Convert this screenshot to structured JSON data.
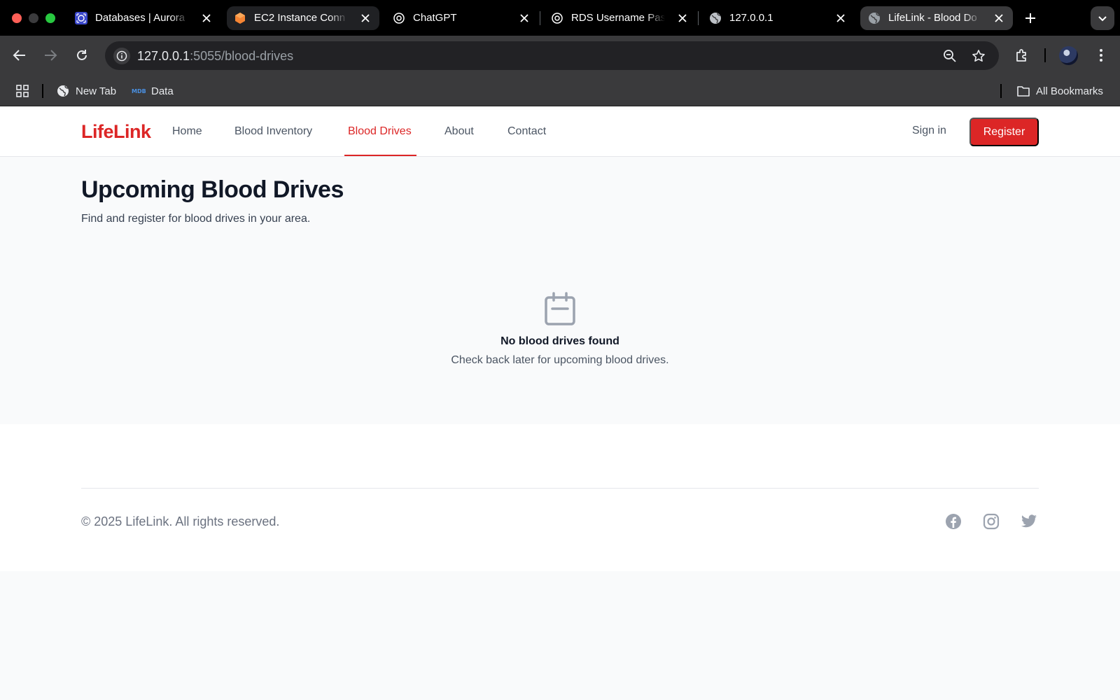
{
  "browser": {
    "tabs": [
      {
        "title": "Databases | Aurora",
        "icon": "aws-rds-icon"
      },
      {
        "title": "EC2 Instance Conn",
        "icon": "aws-ec2-icon"
      },
      {
        "title": "ChatGPT",
        "icon": "openai-icon"
      },
      {
        "title": "RDS Username Pas",
        "icon": "openai-icon"
      },
      {
        "title": "127.0.0.1",
        "icon": "globe-icon"
      },
      {
        "title": "LifeLink - Blood Do",
        "icon": "globe-icon",
        "active": true
      }
    ],
    "url_host": "127.0.0.1",
    "url_path": ":5055/blood-drives",
    "bookmarks": [
      {
        "label": "New Tab",
        "icon": "globe-icon"
      },
      {
        "label": "Data",
        "icon": "mdb-icon"
      }
    ],
    "all_bookmarks_label": "All Bookmarks"
  },
  "site": {
    "logo": "LifeLink",
    "brand_color": "#dc2626",
    "nav": [
      {
        "label": "Home"
      },
      {
        "label": "Blood Inventory"
      },
      {
        "label": "Blood Drives",
        "active": true
      },
      {
        "label": "About"
      },
      {
        "label": "Contact"
      }
    ],
    "signin_label": "Sign in",
    "register_label": "Register"
  },
  "main": {
    "title": "Upcoming Blood Drives",
    "subtitle": "Find and register for blood drives in your area.",
    "empty_icon": "calendar-icon",
    "empty_title": "No blood drives found",
    "empty_subtitle": "Check back later for upcoming blood drives."
  },
  "footer": {
    "copyright": "© 2025 LifeLink. All rights reserved.",
    "social": [
      "facebook-icon",
      "instagram-icon",
      "twitter-icon"
    ]
  }
}
